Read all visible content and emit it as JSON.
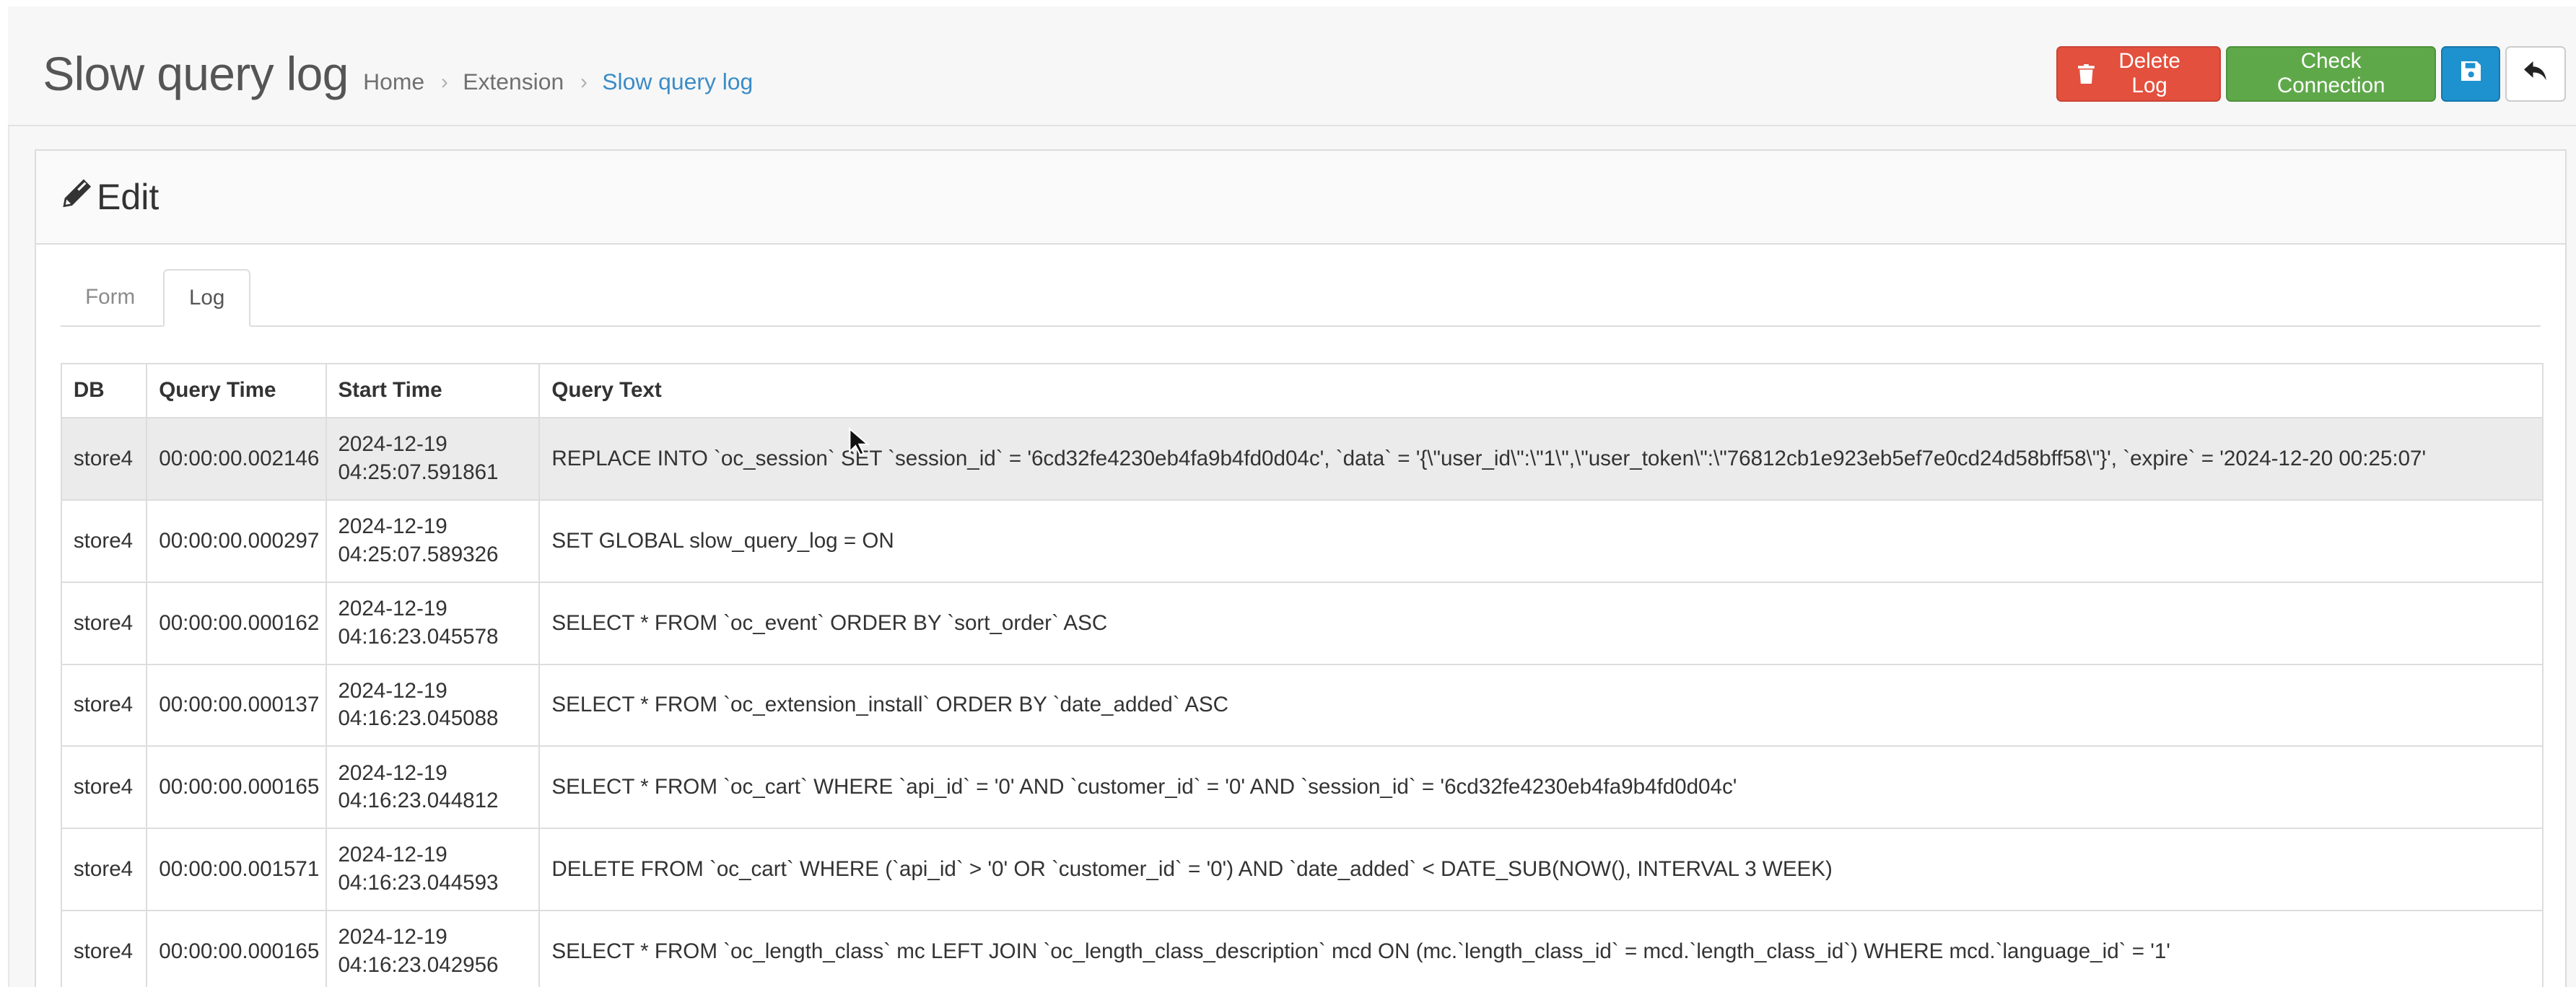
{
  "header": {
    "title": "Slow query log",
    "breadcrumb": [
      {
        "label": "Home"
      },
      {
        "label": "Extension"
      },
      {
        "label": "Slow query log"
      }
    ],
    "separator_glyph": "›"
  },
  "actions": {
    "delete_log_label": "Delete Log",
    "check_connection_label": "Check Connection",
    "save_icon": "save-icon",
    "back_icon": "reply-icon"
  },
  "panel": {
    "title": "Edit",
    "title_icon": "pencil-icon"
  },
  "tabs": [
    {
      "label": "Form",
      "active": false
    },
    {
      "label": "Log",
      "active": true
    }
  ],
  "table": {
    "headers": [
      "DB",
      "Query Time",
      "Start Time",
      "Query Text"
    ],
    "rows": [
      {
        "db": "store4",
        "query_time": "00:00:00.002146",
        "start_date": "2024-12-19",
        "start_time": "04:25:07.591861",
        "query": "REPLACE INTO `oc_session` SET `session_id` = '6cd32fe4230eb4fa9b4fd0d04c', `data` = '{\\\"user_id\\\":\\\"1\\\",\\\"user_token\\\":\\\"76812cb1e923eb5ef7e0cd24d58bff58\\\"}', `expire` = '2024-12-20 00:25:07'"
      },
      {
        "db": "store4",
        "query_time": "00:00:00.000297",
        "start_date": "2024-12-19",
        "start_time": "04:25:07.589326",
        "query": "SET GLOBAL slow_query_log = ON"
      },
      {
        "db": "store4",
        "query_time": "00:00:00.000162",
        "start_date": "2024-12-19",
        "start_time": "04:16:23.045578",
        "query": "SELECT * FROM `oc_event` ORDER BY `sort_order` ASC"
      },
      {
        "db": "store4",
        "query_time": "00:00:00.000137",
        "start_date": "2024-12-19",
        "start_time": "04:16:23.045088",
        "query": "SELECT * FROM `oc_extension_install` ORDER BY `date_added` ASC"
      },
      {
        "db": "store4",
        "query_time": "00:00:00.000165",
        "start_date": "2024-12-19",
        "start_time": "04:16:23.044812",
        "query": "SELECT * FROM `oc_cart` WHERE `api_id` = '0' AND `customer_id` = '0' AND `session_id` = '6cd32fe4230eb4fa9b4fd0d04c'"
      },
      {
        "db": "store4",
        "query_time": "00:00:00.001571",
        "start_date": "2024-12-19",
        "start_time": "04:16:23.044593",
        "query": "DELETE FROM `oc_cart` WHERE (`api_id` > '0' OR `customer_id` = '0') AND `date_added` < DATE_SUB(NOW(), INTERVAL 3 WEEK)"
      },
      {
        "db": "store4",
        "query_time": "00:00:00.000165",
        "start_date": "2024-12-19",
        "start_time": "04:16:23.042956",
        "query": "SELECT * FROM `oc_length_class` mc LEFT JOIN `oc_length_class_description` mcd ON (mc.`length_class_id` = mcd.`length_class_id`) WHERE mcd.`language_id` = '1'"
      }
    ]
  },
  "colors": {
    "danger": "#e3503e",
    "success": "#5fa84a",
    "primary": "#1e91cf",
    "breadcrumb_active": "#3a8cc7"
  }
}
